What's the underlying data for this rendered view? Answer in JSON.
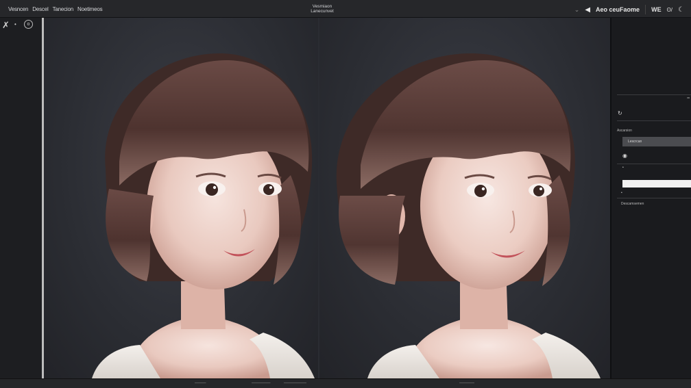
{
  "menu": {
    "items": [
      "Vesncen",
      "Descel",
      "Tanecion",
      "Noetimeos"
    ]
  },
  "window": {
    "title_line1": "Vesmiaon",
    "title_line2": "Lanecunvet"
  },
  "topright": {
    "label": "Aeo ceuFaome",
    "workspace": "WE"
  },
  "left_panel": {
    "collapse_glyph": "‹"
  },
  "bottom": {
    "left_label": "———",
    "mid_label": "—————",
    "right_label": "——————",
    "far_label": "————"
  },
  "right_panel": {
    "section_label": "Ascarsion",
    "field_value": "Lescrcan",
    "footer_label": "Descamsemen"
  }
}
